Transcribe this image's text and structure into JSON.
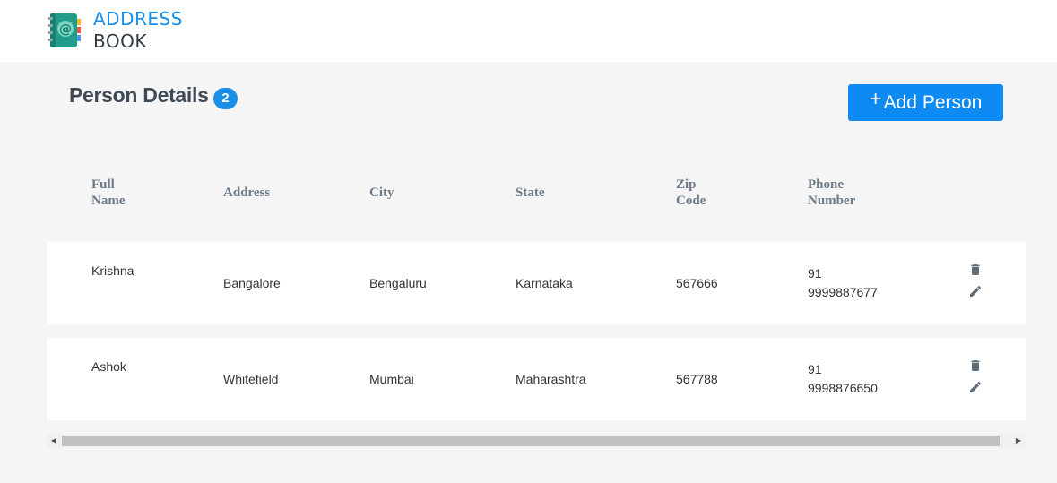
{
  "header": {
    "logo_line1": "ADDRESS",
    "logo_line2": "BOOK",
    "logo_icon": "address-book-icon"
  },
  "page": {
    "title": "Person Details",
    "count": "2",
    "add_button_plus": "+",
    "add_button_label": "Add Person"
  },
  "table": {
    "headers": {
      "full_name_1": "Full",
      "full_name_2": "Name",
      "address": "Address",
      "city": "City",
      "state": "State",
      "zip_1": "Zip",
      "zip_2": "Code",
      "phone_1": "Phone",
      "phone_2": "Number"
    },
    "rows": [
      {
        "name": "Krishna",
        "address": "Bangalore",
        "city": "Bengaluru",
        "state": "Karnataka",
        "zip": "567666",
        "phone_code": "91",
        "phone_number": "9999887677"
      },
      {
        "name": "Ashok",
        "address": "Whitefield",
        "city": "Mumbai",
        "state": "Maharashtra",
        "zip": "567788",
        "phone_code": "91",
        "phone_number": "9998876650"
      }
    ],
    "actions": {
      "delete_icon": "trash-icon",
      "edit_icon": "pencil-icon"
    }
  },
  "colors": {
    "accent": "#1a8fe8",
    "button": "#0d8bf2",
    "title": "#3f4a57",
    "header_text": "#6d7b88",
    "background": "#f5f5f5"
  }
}
